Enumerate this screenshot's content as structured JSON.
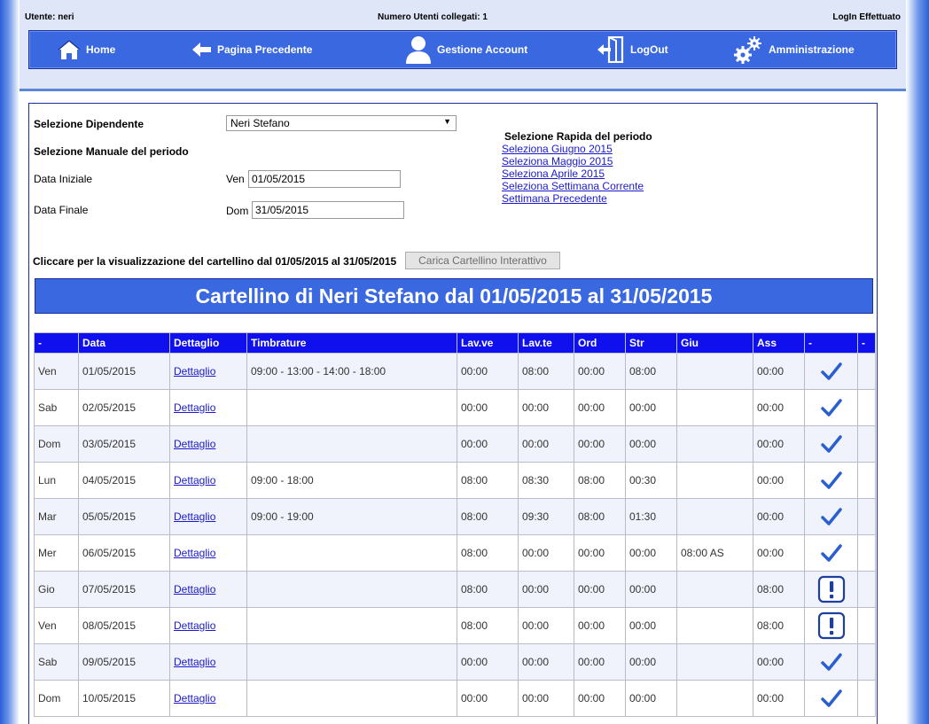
{
  "header": {
    "user": "Utente: neri",
    "connected": "Numero Utenti collegati: 1",
    "login_status": "LogIn Effettuato"
  },
  "nav": {
    "home": "Home",
    "back": "Pagina Precedente",
    "account": "Gestione Account",
    "logout": "LogOut",
    "admin": "Amministrazione"
  },
  "form": {
    "employee_label": "Selezione Dipendente",
    "employee_value": "Neri Stefano",
    "manual_period_label": "Selezione Manuale del periodo",
    "start_label": "Data Iniziale",
    "start_day": "Ven",
    "start_value": "01/05/2015",
    "end_label": "Data Finale",
    "end_day": "Dom",
    "end_value": "31/05/2015",
    "quick_title": "Selezione Rapida del periodo",
    "quick_links": [
      "Seleziona Giugno 2015",
      "Seleziona Maggio 2015",
      "Seleziona Aprile 2015",
      "Seleziona Settimana Corrente",
      "Settimana Precedente"
    ],
    "click_text": "Cliccare per la visualizzazione del cartellino dal 01/05/2015 al 31/05/2015",
    "load_button": "Carica Cartellino Interattivo"
  },
  "banner": "Cartellino di Neri Stefano dal 01/05/2015 al 31/05/2015",
  "table": {
    "headers": [
      "-",
      "Data",
      "Dettaglio",
      "Timbrature",
      "Lav.ve",
      "Lav.te",
      "Ord",
      "Str",
      "Giu",
      "Ass",
      "-",
      "-"
    ],
    "rows": [
      {
        "day": "Ven",
        "date": "01/05/2015",
        "detail": "Dettaglio",
        "punches": "09:00 - 13:00 - 14:00 - 18:00",
        "lavve": "00:00",
        "lavte": "08:00",
        "ord": "00:00",
        "str": "08:00",
        "giu": "",
        "ass": "00:00",
        "status": "check-icon"
      },
      {
        "day": "Sab",
        "date": "02/05/2015",
        "detail": "Dettaglio",
        "punches": "",
        "lavve": "00:00",
        "lavte": "00:00",
        "ord": "00:00",
        "str": "00:00",
        "giu": "",
        "ass": "00:00",
        "status": "check-icon"
      },
      {
        "day": "Dom",
        "date": "03/05/2015",
        "detail": "Dettaglio",
        "punches": "",
        "lavve": "00:00",
        "lavte": "00:00",
        "ord": "00:00",
        "str": "00:00",
        "giu": "",
        "ass": "00:00",
        "status": "check-icon"
      },
      {
        "day": "Lun",
        "date": "04/05/2015",
        "detail": "Dettaglio",
        "punches": "09:00 - 18:00",
        "lavve": "08:00",
        "lavte": "08:30",
        "ord": "08:00",
        "str": "00:30",
        "giu": "",
        "ass": "00:00",
        "status": "check-icon"
      },
      {
        "day": "Mar",
        "date": "05/05/2015",
        "detail": "Dettaglio",
        "punches": "09:00 - 19:00",
        "lavve": "08:00",
        "lavte": "09:30",
        "ord": "08:00",
        "str": "01:30",
        "giu": "",
        "ass": "00:00",
        "status": "check-icon"
      },
      {
        "day": "Mer",
        "date": "06/05/2015",
        "detail": "Dettaglio",
        "punches": "",
        "lavve": "08:00",
        "lavte": "00:00",
        "ord": "00:00",
        "str": "00:00",
        "giu": "08:00 AS",
        "ass": "00:00",
        "status": "check-icon"
      },
      {
        "day": "Gio",
        "date": "07/05/2015",
        "detail": "Dettaglio",
        "punches": "",
        "lavve": "08:00",
        "lavte": "00:00",
        "ord": "00:00",
        "str": "00:00",
        "giu": "",
        "ass": "08:00",
        "status": "warning-icon"
      },
      {
        "day": "Ven",
        "date": "08/05/2015",
        "detail": "Dettaglio",
        "punches": "",
        "lavve": "08:00",
        "lavte": "00:00",
        "ord": "00:00",
        "str": "00:00",
        "giu": "",
        "ass": "08:00",
        "status": "warning-icon"
      },
      {
        "day": "Sab",
        "date": "09/05/2015",
        "detail": "Dettaglio",
        "punches": "",
        "lavve": "00:00",
        "lavte": "00:00",
        "ord": "00:00",
        "str": "00:00",
        "giu": "",
        "ass": "00:00",
        "status": "check-icon"
      },
      {
        "day": "Dom",
        "date": "10/05/2015",
        "detail": "Dettaglio",
        "punches": "",
        "lavve": "00:00",
        "lavte": "00:00",
        "ord": "00:00",
        "str": "00:00",
        "giu": "",
        "ass": "00:00",
        "status": "check-icon"
      }
    ]
  },
  "colors": {
    "nav_blue": "#3a68e0",
    "header_blue": "#1010ee",
    "check_blue": "#2a5fd0",
    "link": "#1a1acc"
  }
}
